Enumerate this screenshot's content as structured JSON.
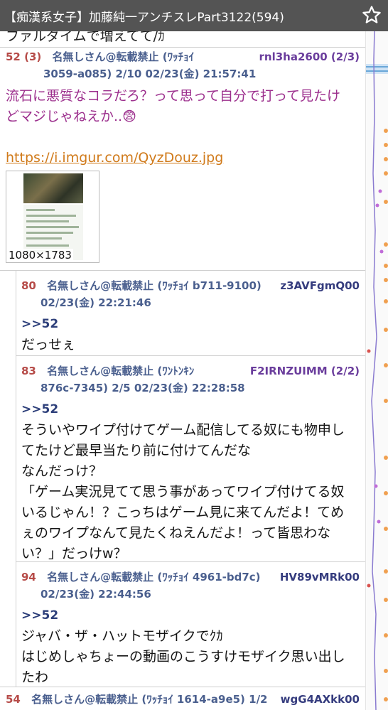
{
  "header": {
    "title": "【痴漢系女子】加藤純一アンチスレPart3122(594)",
    "star_icon": "star-outline-icon"
  },
  "prev_text": "ファルダイムで増えてて/ｶ",
  "posts": [
    {
      "num": "52 (3)",
      "name": "名無しさん@転載禁止 (ﾜｯﾁｮｲ",
      "id": "rnl3ha2600 (2/3)",
      "meta2": "3059-a085) 2/10  02/23(金) 21:57:41",
      "line1": "流石に悪質なコラだろ？って思って自分で打って見たけ",
      "line2": "どマジじゃねえか..😨",
      "link": "https://i.imgur.com/QyzDouz.jpg",
      "image_size": "1080×1783"
    },
    {
      "num": "80",
      "name": "名無しさん@転載禁止 (ﾜｯﾁｮｲ b711-9100)",
      "id": "z3AVFgmQ00",
      "meta2": "02/23(金) 22:21:46",
      "anchor": ">>52",
      "lines": [
        "だっせぇ"
      ]
    },
    {
      "num": "83",
      "name": "名無しさん@転載禁止 (ﾜﾝﾄﾝｷﾝ",
      "id": "F2IRNZUIMM (2/2)",
      "meta2": "876c-7345) 2/5  02/23(金) 22:28:58",
      "anchor": ">>52",
      "lines": [
        "そういやワイプ付けてゲーム配信してる奴にも物申し",
        "てたけど最早当たり前に付けてんだな",
        "なんだっけ？",
        "「ゲーム実況見てて思う事があってワイプ付けてる奴",
        "いるじゃん！？こっちはゲーム見に来てんだよ！てめ",
        "ぇのワイプなんて見たくねえんだよ！って皆思わな",
        "い？」だっけw？"
      ]
    },
    {
      "num": "94",
      "name": "名無しさん@転載禁止 (ﾜｯﾁｮｲ 4961-bd7c)",
      "id": "HV89vMRk00",
      "meta2": "02/23(金) 22:44:56",
      "anchor": ">>52",
      "lines": [
        "ジャバ・ザ・ハットモザイクでｸｶ",
        "はじめしゃちょーの動画のこうすけモザイク思い出し",
        "たわ"
      ]
    },
    {
      "num": "54",
      "name": "名無しさん@転載禁止 (ﾜｯﾁｮｲ 1614-a9e5) 1/2",
      "id": "wgG4AXkk00"
    }
  ]
}
